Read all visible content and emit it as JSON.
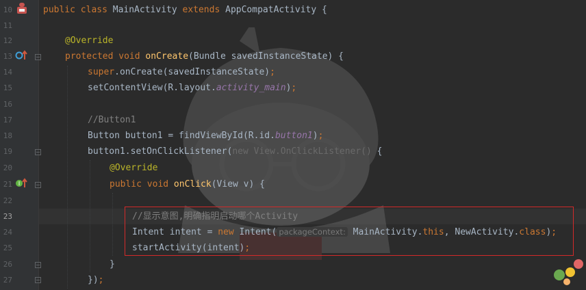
{
  "colors": {
    "background": "#2b2b2b",
    "gutter": "#313335",
    "keyword": "#cc7832",
    "annotation": "#bbb529",
    "method": "#ffc66d",
    "field": "#9876aa",
    "comment": "#808080",
    "text": "#a9b7c6",
    "highlight_border": "#d42a2a"
  },
  "editor": {
    "line_numbers": [
      "10",
      "11",
      "12",
      "13",
      "14",
      "15",
      "16",
      "17",
      "18",
      "19",
      "20",
      "21",
      "22",
      "23",
      "24",
      "25",
      "26",
      "27"
    ],
    "current_line": "23",
    "lines": {
      "l10": {
        "kw1": "public class ",
        "name": "MainActivity ",
        "kw2": "extends ",
        "rest": "AppCompatActivity {"
      },
      "l12": {
        "ann": "@Override"
      },
      "l13": {
        "kw": "protected void ",
        "fn": "onCreate",
        "rest": "(Bundle savedInstanceState) {"
      },
      "l14": {
        "kw": "super",
        "rest": ".onCreate(savedInstanceState)",
        "semi": ";"
      },
      "l15": {
        "a": "setContentView(R.layout.",
        "fld": "activity_main",
        "b": ")",
        "semi": ";"
      },
      "l17": {
        "cmt": "//Button1"
      },
      "l18": {
        "a": "Button button1 = findViewById(R.id.",
        "fld": "button1",
        "b": ")",
        "semi": ";"
      },
      "l19": {
        "a": "button1.setOnClickListener(",
        "dim": "new View.OnClickListener() ",
        "b": "{"
      },
      "l20": {
        "ann": "@Override"
      },
      "l21": {
        "kw": "public void ",
        "fn": "onClick",
        "rest": "(View v) {"
      },
      "l23": {
        "cmt": "//显示意图,明确指明启动哪个Activity"
      },
      "l24": {
        "a": "Intent intent = ",
        "kw": "new ",
        "b": "Intent(",
        "hint": "packageContext:",
        "c": " MainActivity.",
        "kw2": "this",
        "d": ", NewActivity.",
        "kw3": "class",
        "e": ")",
        "semi": ";"
      },
      "l25": {
        "a": "startActivity(intent)",
        "semi": ";"
      },
      "l26": {
        "a": "}"
      },
      "l27": {
        "a": "})",
        "semi": ";"
      }
    }
  },
  "icons": {
    "line10": "android-class-icon",
    "line13": "override-method-icon",
    "line21": "implement-method-icon",
    "fold": "fold-marker-icon"
  }
}
